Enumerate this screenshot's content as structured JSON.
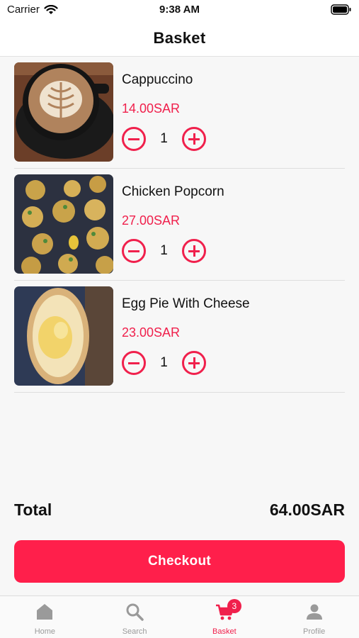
{
  "status": {
    "carrier": "Carrier",
    "time": "9:38 AM"
  },
  "header": {
    "title": "Basket"
  },
  "items": [
    {
      "name": "Cappuccino",
      "price": "14.00SAR",
      "qty": "1",
      "image": "cappuccino-photo"
    },
    {
      "name": "Chicken Popcorn",
      "price": "27.00SAR",
      "qty": "1",
      "image": "chicken-popcorn-photo"
    },
    {
      "name": "Egg Pie With Cheese",
      "price": "23.00SAR",
      "qty": "1",
      "image": "egg-pie-photo"
    }
  ],
  "summary": {
    "total_label": "Total",
    "total_value": "64.00SAR"
  },
  "checkout": {
    "label": "Checkout"
  },
  "tabs": [
    {
      "label": "Home",
      "icon": "home-icon"
    },
    {
      "label": "Search",
      "icon": "search-icon"
    },
    {
      "label": "Basket",
      "icon": "cart-icon",
      "badge": "3",
      "active": true
    },
    {
      "label": "Profile",
      "icon": "person-icon"
    }
  ],
  "colors": {
    "accent": "#f0204c",
    "checkout_bg": "#ff1f4b",
    "tab_inactive": "#9a9a9a"
  }
}
